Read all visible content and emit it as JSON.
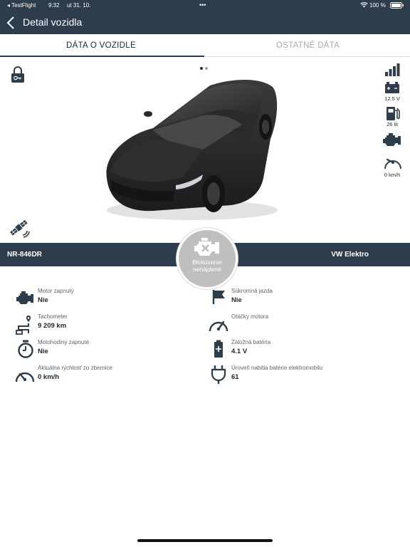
{
  "status_bar": {
    "back_app": "◂ TestFlight",
    "time": "9:32",
    "date": "ut 31. 10.",
    "dots": "•••",
    "battery": "100 %"
  },
  "nav": {
    "title": "Detail vozidla"
  },
  "tabs": [
    {
      "label": "DÁTA O VOZIDLE",
      "active": true
    },
    {
      "label": "OSTATNÉ DÁTA",
      "active": false
    }
  ],
  "pager": {
    "count": 2,
    "active_index": 0
  },
  "side_indicators": {
    "battery_voltage": "12.5 V",
    "fuel": "26 lit",
    "speed": "0 km/h"
  },
  "vehicle": {
    "plate": "NR-846DR",
    "model": "VW Elektro",
    "engine_status": [
      "Blokovanie",
      "nenájdené"
    ]
  },
  "details": [
    {
      "icon": "engine-icon",
      "label": "Motor zapnutý",
      "value": "Nie"
    },
    {
      "icon": "flag-icon",
      "label": "Súkromná jazda",
      "value": "Nie"
    },
    {
      "icon": "route-icon",
      "label": "Tachometer",
      "value": "9 209 km"
    },
    {
      "icon": "gauge-icon",
      "label": "Otáčky motora",
      "value": ""
    },
    {
      "icon": "stopwatch-icon",
      "label": "Motohodiny zapnuté",
      "value": "Nie"
    },
    {
      "icon": "backup-battery-icon",
      "label": "Záložná batéria",
      "value": "4.1 V"
    },
    {
      "icon": "speedometer-icon",
      "label": "Aktuálna rýchlosť zo zbernice",
      "value": "0 km/h"
    },
    {
      "icon": "ev-plug-icon",
      "label": "Úroveň nabitia batérie elektromobilu",
      "value": "61"
    }
  ],
  "colors": {
    "primary": "#2e3d4c",
    "engine_circle": "#bfbfbf",
    "tab_inactive": "#a4abb2"
  }
}
